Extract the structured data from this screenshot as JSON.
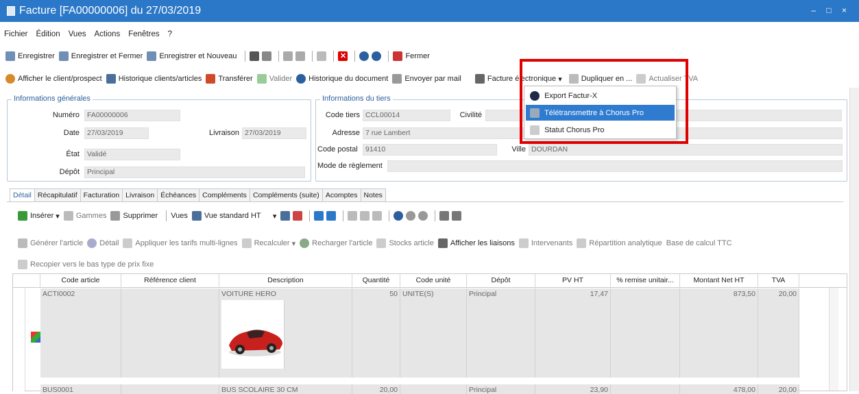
{
  "window": {
    "title": "Facture [FA00000006] du 27/03/2019",
    "controls": "– □ ×"
  },
  "menu": [
    "Fichier",
    "Édition",
    "Vues",
    "Actions",
    "Fenêtres",
    "?"
  ],
  "toolbar1": {
    "save": "Enregistrer",
    "save_close": "Enregistrer et Fermer",
    "save_new": "Enregistrer et Nouveau",
    "close": "Fermer"
  },
  "toolbar2": {
    "show_client": "Afficher le client/prospect",
    "history_clients": "Historique clients/articles",
    "transfer": "Transférer",
    "validate": "Valider",
    "history_doc": "Historique du document",
    "send_mail": "Envoyer par mail",
    "e_invoice": "Facture électronique",
    "duplicate": "Dupliquer en ...",
    "update_vat": "Actualiser TVA"
  },
  "dropdown": {
    "items": [
      "Export Factur-X",
      "Télétransmettre à Chorus Pro",
      "Statut Chorus Pro"
    ]
  },
  "general": {
    "title": "Informations générales",
    "numero_label": "Numéro",
    "numero": "FA00000006",
    "date_label": "Date",
    "date": "27/03/2019",
    "livraison_label": "Livraison",
    "livraison": "27/03/2019",
    "etat_label": "État",
    "etat": "Validé",
    "depot_label": "Dépôt",
    "depot": "Principal"
  },
  "tiers": {
    "title": "Informations du tiers",
    "code_label": "Code tiers",
    "code": "CCL00014",
    "civilite_label": "Civilité",
    "adresse_label": "Adresse",
    "adresse": "7 rue Lambert",
    "cp_label": "Code postal",
    "cp": "91410",
    "ville_label": "Ville",
    "ville": "DOURDAN",
    "reglement_label": "Mode de règlement"
  },
  "tabs": [
    "Détail",
    "Récapitulatif",
    "Facturation",
    "Livraison",
    "Échéances",
    "Compléments",
    "Compléments (suite)",
    "Acomptes",
    "Notes"
  ],
  "detail_toolbar": {
    "insert": "Insérer",
    "gammes": "Gammes",
    "delete": "Supprimer",
    "vues": "Vues",
    "view": "Vue standard HT"
  },
  "actions_row": {
    "generate": "Générer l'article",
    "detail": "Détail",
    "apply_tariffs": "Appliquer les tarifs multi-lignes",
    "recalc": "Recalculer",
    "reload": "Recharger l'article",
    "stocks": "Stocks article",
    "links": "Afficher les liaisons",
    "intervenants": "Intervenants",
    "analytic": "Répartition analytique",
    "base_ttc": "Base de calcul TTC"
  },
  "copy_row": "Recopier vers le bas type de prix fixe",
  "grid": {
    "headers": [
      "Code article",
      "Référence client",
      "Description",
      "Quantité",
      "Code unité",
      "Dépôt",
      "PV HT",
      "% remise unitair...",
      "Montant Net HT",
      "TVA"
    ],
    "rows": [
      {
        "code": "ACTI0002",
        "ref": "",
        "desc": "VOITURE HERO",
        "qty": "50",
        "unit": "UNITE(S)",
        "depot": "Principal",
        "pv": "17,47",
        "remise": "",
        "montant": "873,50",
        "tva": "20,00"
      },
      {
        "code": "BUS0001",
        "ref": "",
        "desc": "BUS SCOLAIRE 30 CM",
        "qty": "20,00",
        "unit": "",
        "depot": "Principal",
        "pv": "23,90",
        "remise": "",
        "montant": "478,00",
        "tva": "20,00"
      }
    ]
  }
}
